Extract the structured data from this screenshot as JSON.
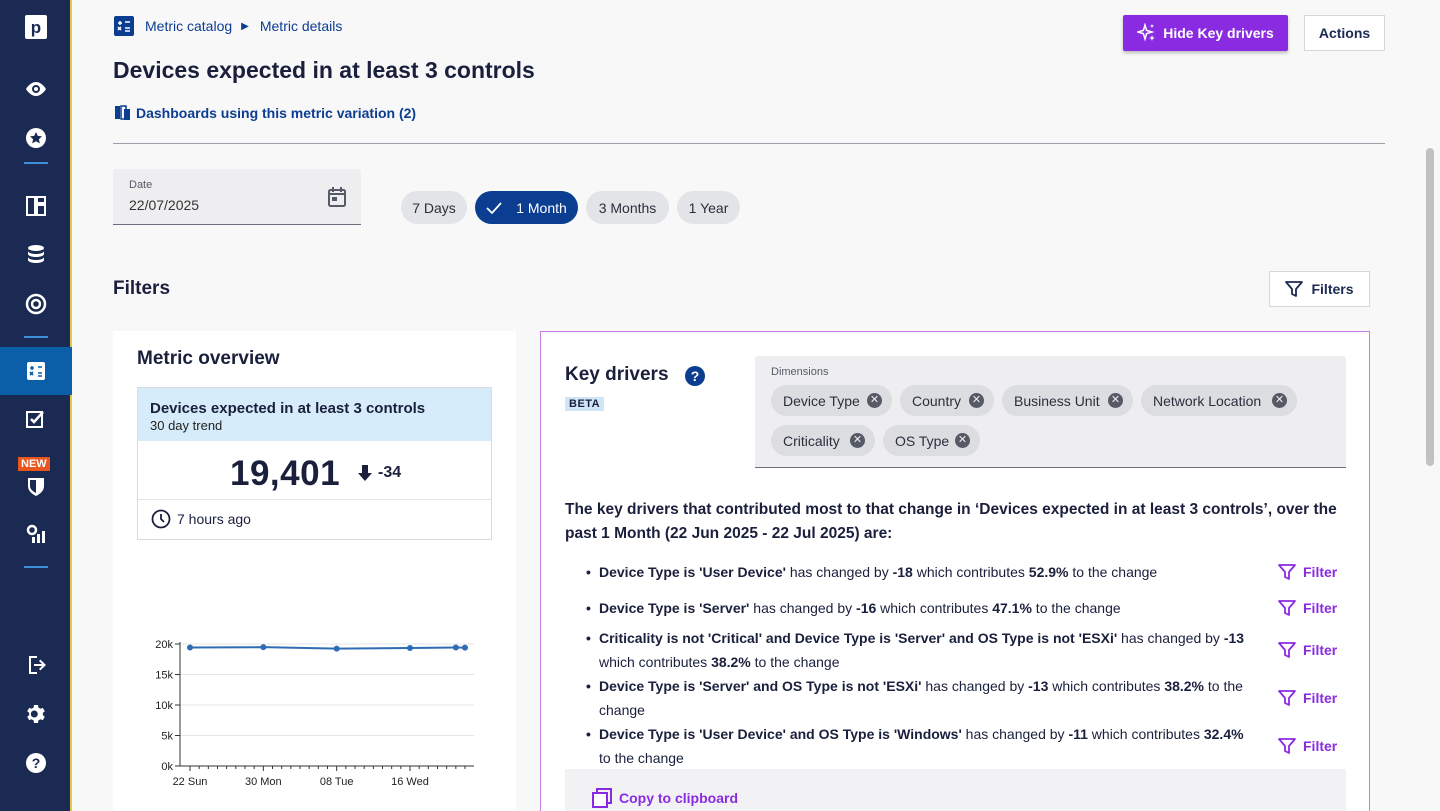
{
  "sidebar": {
    "logo_letter": "p",
    "new_badge": "NEW",
    "icons": [
      "eye-icon",
      "star-icon",
      "dashboard-icon",
      "database-icon",
      "target-icon",
      "metric-catalog-icon",
      "checklist-icon",
      "shield-icon",
      "settings-chart-icon",
      "logout-icon",
      "gear-icon",
      "help-icon"
    ]
  },
  "breadcrumb": {
    "item1": "Metric catalog",
    "item2": "Metric details"
  },
  "page": {
    "title": "Devices expected in at least 3 controls",
    "dash_link": "Dashboards using this metric variation (2)"
  },
  "header": {
    "hide_key_drivers": "Hide Key drivers",
    "actions": "Actions"
  },
  "date": {
    "label": "Date",
    "value": "22/07/2025"
  },
  "ranges": [
    "7 Days",
    "1 Month",
    "3 Months",
    "1 Year"
  ],
  "selected_range": "1 Month",
  "filters": {
    "title": "Filters",
    "button": "Filters"
  },
  "overview": {
    "title": "Metric overview",
    "metric_name": "Devices expected in at least 3 controls",
    "trend_label": "30 day trend",
    "value": "19,401",
    "delta": "-34",
    "updated": "7 hours ago"
  },
  "chart_data": {
    "type": "line",
    "y_ticks": [
      "0k",
      "5k",
      "10k",
      "15k",
      "20k"
    ],
    "x_ticks": [
      "22 Sun",
      "30 Mon",
      "08 Tue",
      "16 Wed"
    ],
    "ylim": [
      0,
      20000
    ],
    "x": [
      "2025-06-22",
      "2025-06-30",
      "2025-07-08",
      "2025-07-16",
      "2025-07-21",
      "2025-07-22"
    ],
    "values": [
      19435,
      19480,
      19250,
      19350,
      19420,
      19401
    ]
  },
  "key_drivers": {
    "title": "Key drivers",
    "beta": "BETA",
    "dimensions_label": "Dimensions",
    "dimensions": [
      "Device Type",
      "Country",
      "Business Unit",
      "Network Location",
      "Criticality",
      "OS Type"
    ],
    "summary": "The key drivers that contributed most to that change in ‘Devices expected in at least 3 controls’, over the past 1 Month (22 Jun 2025 - 22 Jul 2025) are:",
    "filter_label": "Filter",
    "copy": "Copy to clipboard",
    "drivers": [
      {
        "cond": "Device Type is 'User Device'",
        "mid": " has changed by ",
        "change": "-18",
        "mid2": " which contributes ",
        "pct": "52.9%",
        "tail": " to the change"
      },
      {
        "cond": "Device Type is 'Server'",
        "mid": " has changed by ",
        "change": "-16",
        "mid2": " which contributes ",
        "pct": "47.1%",
        "tail": " to the change"
      },
      {
        "cond": "Criticality is not 'Critical' and Device Type is 'Server' and OS Type is not 'ESXi'",
        "mid": " has changed by ",
        "change": "-13",
        "mid2": " which contributes ",
        "pct": "38.2%",
        "tail": " to the change"
      },
      {
        "cond": "Device Type is 'Server' and OS Type is not 'ESXi'",
        "mid": " has changed by ",
        "change": "-13",
        "mid2": " which contributes ",
        "pct": "38.2%",
        "tail": " to the change"
      },
      {
        "cond": "Device Type is 'User Device' and OS Type is 'Windows'",
        "mid": " has changed by ",
        "change": "-11",
        "mid2": " which contributes ",
        "pct": "32.4%",
        "tail": " to the change"
      }
    ]
  }
}
